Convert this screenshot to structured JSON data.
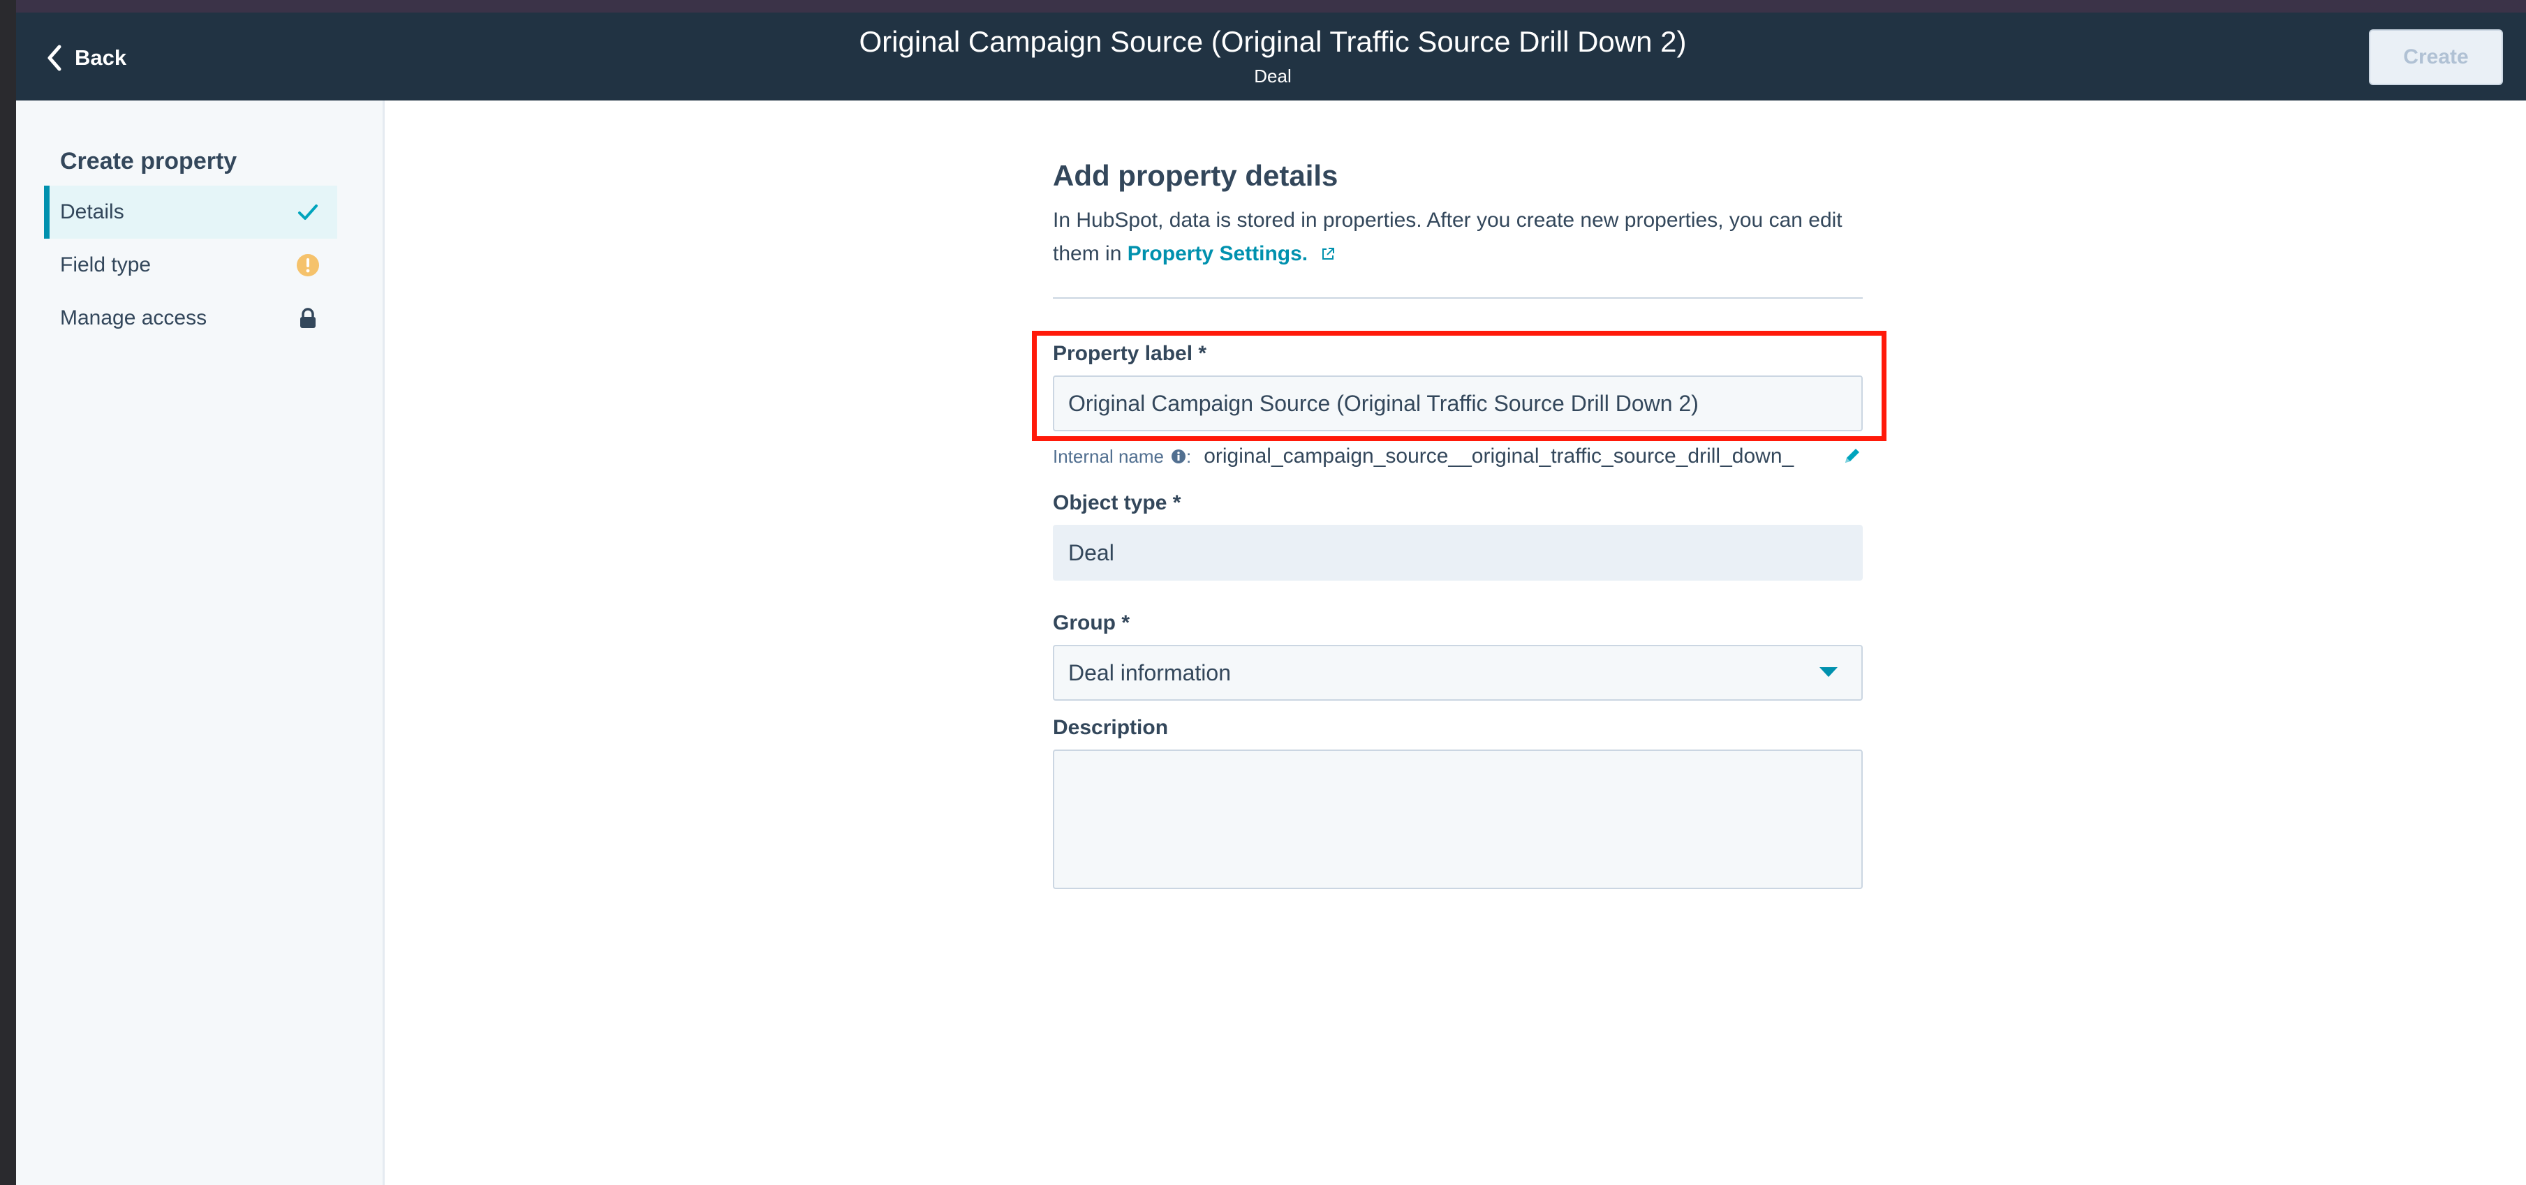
{
  "header": {
    "back_label": "Back",
    "title": "Original Campaign Source (Original Traffic Source Drill Down 2)",
    "subtitle": "Deal",
    "create_label": "Create"
  },
  "sidebar": {
    "heading": "Create property",
    "steps": [
      {
        "label": "Details",
        "status_icon": "check-icon",
        "active": true
      },
      {
        "label": "Field type",
        "status_icon": "warning-icon",
        "active": false
      },
      {
        "label": "Manage access",
        "status_icon": "lock-icon",
        "active": false
      }
    ]
  },
  "main": {
    "heading": "Add property details",
    "intro_text": "In HubSpot, data is stored in properties. After you create new properties, you can edit them in",
    "intro_link": "Property Settings.",
    "property_label": {
      "label": "Property label *",
      "value": "Original Campaign Source (Original Traffic Source Drill Down 2)"
    },
    "internal_name": {
      "label": "Internal name",
      "value": "original_campaign_source__original_traffic_source_drill_down_"
    },
    "object_type": {
      "label": "Object type *",
      "value": "Deal"
    },
    "group": {
      "label": "Group *",
      "value": "Deal information"
    },
    "description": {
      "label": "Description",
      "value": ""
    }
  },
  "colors": {
    "header_bg": "#213343",
    "accent": "#0091ae",
    "highlight": "#ff1a0a",
    "warning": "#f5c26b",
    "success": "#00bda5"
  }
}
